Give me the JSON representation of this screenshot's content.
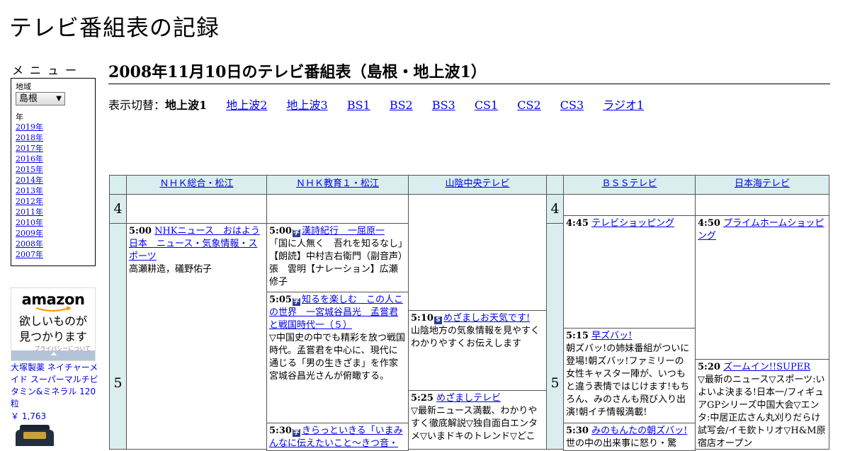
{
  "site": {
    "title": "テレビ番組表の記録"
  },
  "menu": {
    "heading": "メニュー",
    "region_label": "地域",
    "region_value": "島根",
    "year_label": "年",
    "years": [
      "2019年",
      "2018年",
      "2017年",
      "2016年",
      "2015年",
      "2014年",
      "2013年",
      "2012年",
      "2011年",
      "2010年",
      "2009年",
      "2008年",
      "2007年"
    ]
  },
  "ad": {
    "logo": "amazon",
    "copy_line1": "欲しいものが",
    "copy_line2": "見つかります",
    "privacy": "プライバシーについて",
    "product": "大塚製薬 ネイチャーメイド スーパーマルチビタミン&ミネラル 120粒",
    "price": "￥ 1,763"
  },
  "main": {
    "title": "2008年11月10日のテレビ番組表（島根・地上波1）",
    "switch_label": "表示切替：",
    "current": "地上波1",
    "links": [
      "地上波2",
      "地上波3",
      "BS1",
      "BS2",
      "BS3",
      "CS1",
      "CS2",
      "CS3",
      "ラジオ1"
    ]
  },
  "schedule": {
    "channels": [
      "ＮＨＫ総合・松江",
      "ＮＨＫ教育１・松江",
      "山陰中央テレビ",
      "ＢＳＳテレビ",
      "日本海テレビ"
    ],
    "hours": [
      "4",
      "5"
    ],
    "programs": {
      "nhk1_500": {
        "time": "5:00",
        "title": "NHKニュース　おはよう日本　ニュース・気象情報・スポーツ",
        "desc": "高瀬耕造，礒野佑子"
      },
      "etv_500": {
        "time": "5:00",
        "icon": "字",
        "title": "漢詩紀行　一屈原一",
        "desc": "「国に人無く　吾れを知るなし」　【朗読】中村吉右衛門（副音声）張　雲明【ナレーション】広瀬修子"
      },
      "etv_505": {
        "time": "5:05",
        "icon": "字",
        "title": "知るを楽しむ　この人この世界　一宮城谷昌光　孟嘗君と戦国時代一（５）",
        "desc": "▽中国史の中でも精彩を放つ戦国時代。孟嘗君を中心に、現代に通じる「男の生きざま」を作家宮城谷昌光さんが俯瞰する。"
      },
      "etv_530": {
        "time": "5:30",
        "icon": "字",
        "title": "きらっといきる「いまみんなに伝えたいこと～きつ音・",
        "desc": ""
      },
      "tsk_510": {
        "time": "5:10",
        "icon": "S",
        "title": "めざましお天気です!",
        "desc": "山陰地方の気象情報を見やすくわかりやすくお伝えします"
      },
      "tsk_525": {
        "time": "5:25",
        "title": "めざましテレビ",
        "desc": "▽最新ニュース満載、わかりやすく徹底解説▽独自面白エンタメ▽いまドキのトレンド▽どこ"
      },
      "bss_445": {
        "time": "4:45",
        "title": "テレビショッピング",
        "desc": ""
      },
      "bss_515": {
        "time": "5:15",
        "title": "早ズバッ!",
        "desc": "朝ズバッ!の姉妹番組がついに登場!朝ズバッ!ファミリーの女性キャスター陣が、いつもと違う表情ではじけます!もちろん、みのさんも飛び入り出演!朝イチ情報満載!"
      },
      "bss_530": {
        "time": "5:30",
        "title": "みのもんたの朝ズバッ!",
        "desc": "世の中の出来事に怒り・驚"
      },
      "ntv_450": {
        "time": "4:50",
        "title": "プライムホームショッピング",
        "desc": ""
      },
      "ntv_520": {
        "time": "5:20",
        "title": "ズームイン!!SUPER",
        "desc": "▽最新のニュース▽スポーツ:いよいよ決まる!日本一/フィギュアGPシリーズ中国大会▽エンタ:中居正広さん丸刈りだらけ試写会/イモ欽トリオ▽H&M原宿店オープン"
      }
    }
  },
  "colors": {
    "header_bg": "#daeeee",
    "link": "#0000ee"
  }
}
